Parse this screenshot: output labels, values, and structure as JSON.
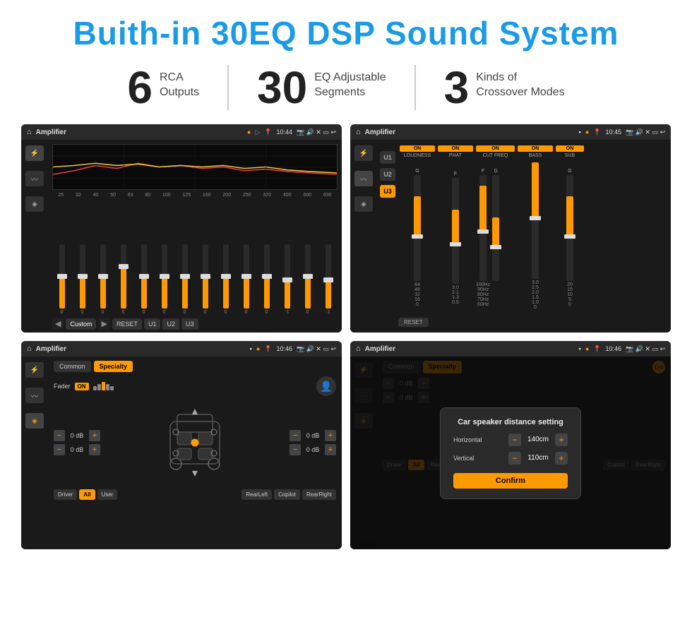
{
  "header": {
    "title": "Buith-in 30EQ DSP Sound System"
  },
  "stats": [
    {
      "number": "6",
      "line1": "RCA",
      "line2": "Outputs"
    },
    {
      "number": "30",
      "line1": "EQ Adjustable",
      "line2": "Segments"
    },
    {
      "number": "3",
      "line1": "Kinds of",
      "line2": "Crossover Modes"
    }
  ],
  "screens": [
    {
      "id": "eq-screen",
      "statusBar": {
        "appName": "Amplifier",
        "time": "10:44"
      },
      "freqLabels": [
        "25",
        "32",
        "40",
        "50",
        "63",
        "80",
        "100",
        "125",
        "160",
        "200",
        "250",
        "320",
        "400",
        "500",
        "630"
      ],
      "sliderValues": [
        "0",
        "0",
        "0",
        "5",
        "0",
        "0",
        "0",
        "0",
        "0",
        "0",
        "0",
        "-1",
        "0",
        "-1"
      ],
      "bottomButtons": [
        "Custom",
        "RESET",
        "U1",
        "U2",
        "U3"
      ]
    },
    {
      "id": "crossover-screen",
      "statusBar": {
        "appName": "Amplifier",
        "time": "10:45"
      },
      "presets": [
        "U1",
        "U2",
        "U3"
      ],
      "channels": [
        {
          "label": "LOUDNESS",
          "on": true
        },
        {
          "label": "PHAT",
          "on": true
        },
        {
          "label": "CUT FREQ",
          "on": true
        },
        {
          "label": "BASS",
          "on": true
        },
        {
          "label": "SUB",
          "on": true
        }
      ]
    },
    {
      "id": "fader-screen",
      "statusBar": {
        "appName": "Amplifier",
        "time": "10:46"
      },
      "tabs": [
        "Common",
        "Specialty"
      ],
      "faderLabel": "Fader",
      "faderOn": "ON",
      "volumes": [
        "0 dB",
        "0 dB",
        "0 dB",
        "0 dB"
      ],
      "bottomButtons": [
        "Driver",
        "All",
        "User",
        "RearLeft",
        "Copilot",
        "RearRight"
      ]
    },
    {
      "id": "dialog-screen",
      "statusBar": {
        "appName": "Amplifier",
        "time": "10:46"
      },
      "tabs": [
        "Common",
        "Specialty"
      ],
      "dialog": {
        "title": "Car speaker distance setting",
        "horizontal": {
          "label": "Horizontal",
          "value": "140cm"
        },
        "vertical": {
          "label": "Vertical",
          "value": "110cm"
        },
        "confirmLabel": "Confirm"
      },
      "volumes": [
        "0 dB",
        "0 dB"
      ],
      "bottomButtons": [
        "Driver",
        "RearLeft",
        "Copilot",
        "RearRight"
      ]
    }
  ]
}
